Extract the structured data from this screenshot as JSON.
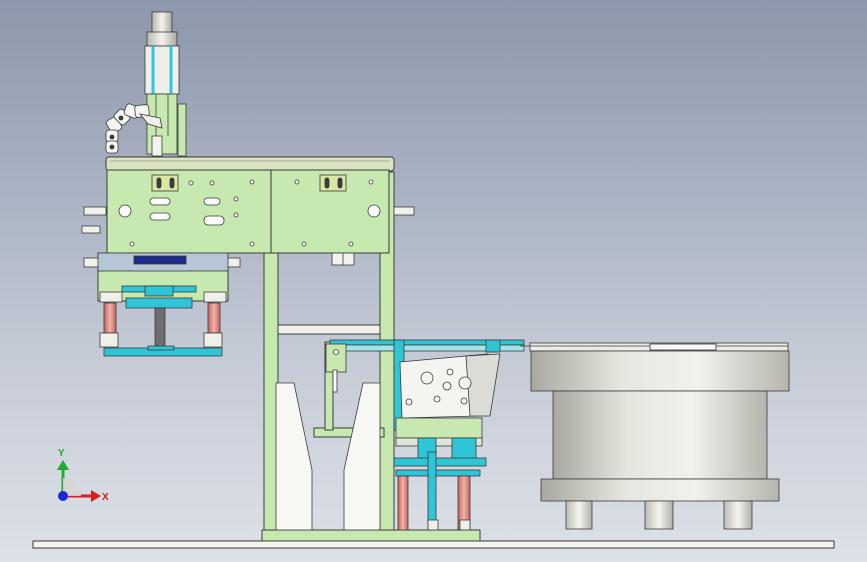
{
  "viewport": {
    "view": "front"
  },
  "triad": {
    "x_label": "X",
    "y_label": "Y",
    "colors": {
      "x": "#d42020",
      "y": "#22aa33",
      "z": "#1a2bd6"
    }
  },
  "colors": {
    "frame_green": "#c7e9b0",
    "cyan_part": "#2ec6d6",
    "steel": "#d8d8d4",
    "outline": "#3a3a3a",
    "bowl_gray": "#d9d9d2",
    "rod_pink": "#e58a82"
  }
}
